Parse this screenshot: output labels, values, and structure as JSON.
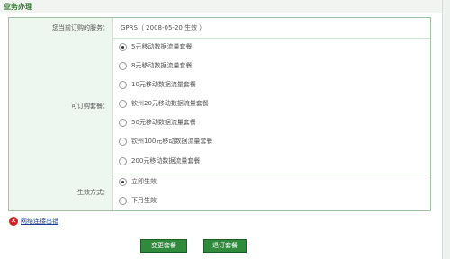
{
  "header": {
    "title": "业务办理"
  },
  "subscription": {
    "current_label": "您当前订购的服务：",
    "current_value": "GPRS（ 2008-05-20 生效 ）"
  },
  "packages": {
    "label": "可订购套餐：",
    "selected_index": 0,
    "options": [
      "5元移动数据流量套餐",
      "8元移动数据流量套餐",
      "10元移动数据流量套餐",
      "钦州20元移动数据流量套餐",
      "50元移动数据流量套餐",
      "钦州100元移动数据流量套餐",
      "200元移动数据流量套餐"
    ]
  },
  "effect": {
    "label": "生效方式：",
    "selected_index": 0,
    "options": [
      "立即生效",
      "下月生效"
    ]
  },
  "error": {
    "link_text": "网络连接出错"
  },
  "buttons": {
    "change": "变更套餐",
    "cancel": "退订套餐"
  },
  "colors": {
    "accent": "#2f8a3c",
    "label_bg": "#eef6f0",
    "border": "#9fc4a4",
    "error": "#d42020"
  }
}
